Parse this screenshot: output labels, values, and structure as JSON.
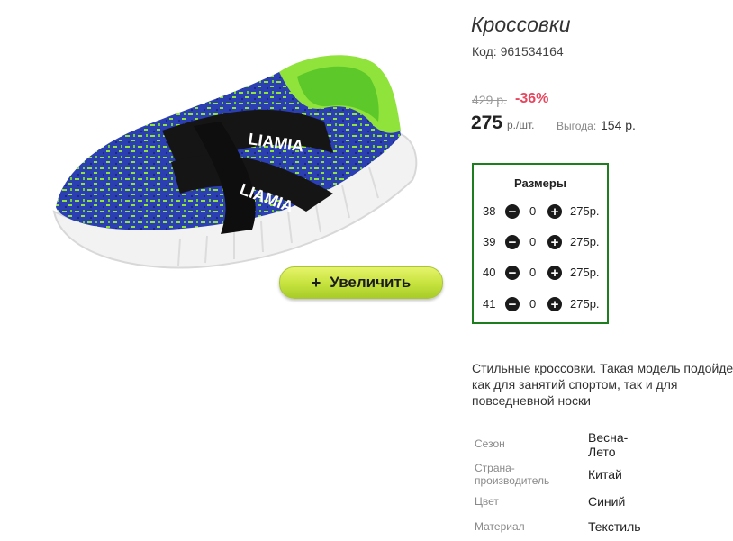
{
  "product": {
    "title": "Кроссовки",
    "sku": "Код: 961534164",
    "old_price": "429 р.",
    "discount": "-36%",
    "price": "275",
    "unit": "р./шт.",
    "saving_label": "Выгода:",
    "saving_value": "154 р.",
    "description": "Стильные кроссовки. Такая модель подойдет как для занятий спортом, так и для повседневной носки"
  },
  "image": {
    "zoom_label": "Увеличить",
    "zoom_icon": "+",
    "brand_print": "LIAMIA"
  },
  "sizes": {
    "title": "Размеры",
    "minus_icon": "−",
    "plus_icon": "+",
    "items": [
      {
        "size": "38",
        "qty": "0",
        "price": "275р."
      },
      {
        "size": "39",
        "qty": "0",
        "price": "275р."
      },
      {
        "size": "40",
        "qty": "0",
        "price": "275р."
      },
      {
        "size": "41",
        "qty": "0",
        "price": "275р."
      }
    ]
  },
  "specs": [
    {
      "label": "Сезон",
      "value": "Весна-\nЛето"
    },
    {
      "label": "Страна-\nпроизводитель",
      "value": "Китай"
    },
    {
      "label": "Цвет",
      "value": "Синий"
    },
    {
      "label": "Материал",
      "value": "Текстиль"
    }
  ],
  "colors": {
    "accent_green_border": "#1e7d1e",
    "discount_red": "#e8455e",
    "button_green": "#c5e23c",
    "shoe_blue": "#2a3fb0",
    "shoe_lime": "#8fe33a"
  }
}
